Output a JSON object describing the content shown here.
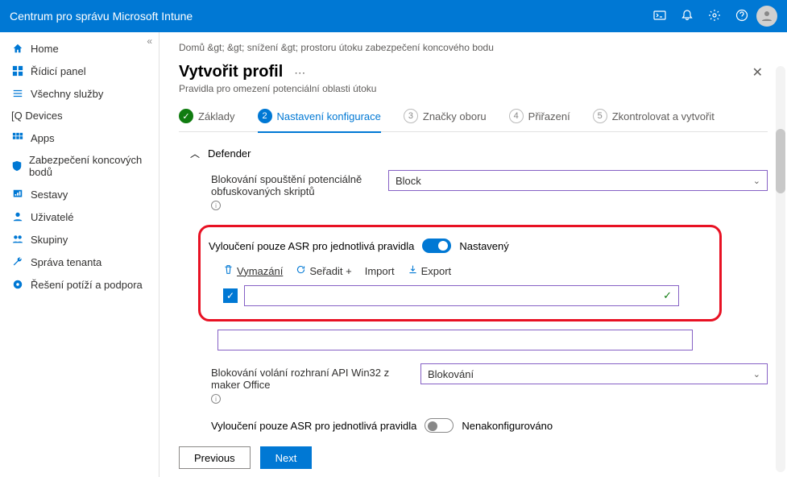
{
  "top": {
    "title": "Centrum pro správu Microsoft Intune"
  },
  "sidebar": {
    "items": [
      {
        "label": "Home"
      },
      {
        "label": "Řídicí panel"
      },
      {
        "label": "Všechny služby"
      },
      {
        "label": "Devices"
      },
      {
        "label": "Apps"
      },
      {
        "label": "Zabezpečení koncových bodů"
      },
      {
        "label": "Sestavy"
      },
      {
        "label": "Uživatelé"
      },
      {
        "label": "Skupiny"
      },
      {
        "label": "Správa tenanta"
      },
      {
        "label": "Řešení potíží a podpora"
      }
    ]
  },
  "breadcrumb": "Domů &gt; &gt; snížení &gt; prostoru útoku zabezpečení koncového bodu",
  "page": {
    "title": "Vytvořit profil",
    "subtitle": "Pravidla pro omezení potenciální oblasti útoku"
  },
  "steps": [
    {
      "num": "✓",
      "label": "Základy"
    },
    {
      "num": "2",
      "label": "Nastavení konfigurace"
    },
    {
      "num": "3",
      "label": "Značky oboru"
    },
    {
      "num": "4",
      "label": "Přiřazení"
    },
    {
      "num": "5",
      "label": "Zkontrolovat a vytvořit"
    }
  ],
  "section": "Defender",
  "field1": {
    "label": "Blokování spouštění potenciálně obfuskovaných skriptů",
    "value": "Block"
  },
  "toggle1": {
    "label": "Vyloučení pouze ASR pro jednotlivá pravidla",
    "state": "Nastavený"
  },
  "toolbar": {
    "clear": "Vymazání",
    "sort": "Seřadit +",
    "import": "Import",
    "export": "Export"
  },
  "field2": {
    "label": "Blokování volání rozhraní API Win32 z maker Office",
    "value": "Blokování"
  },
  "toggle2": {
    "label": "Vyloučení pouze ASR pro jednotlivá pravidla",
    "state": "Nenakonfigurováno"
  },
  "footer": {
    "prev": "Previous",
    "next": "Next"
  }
}
